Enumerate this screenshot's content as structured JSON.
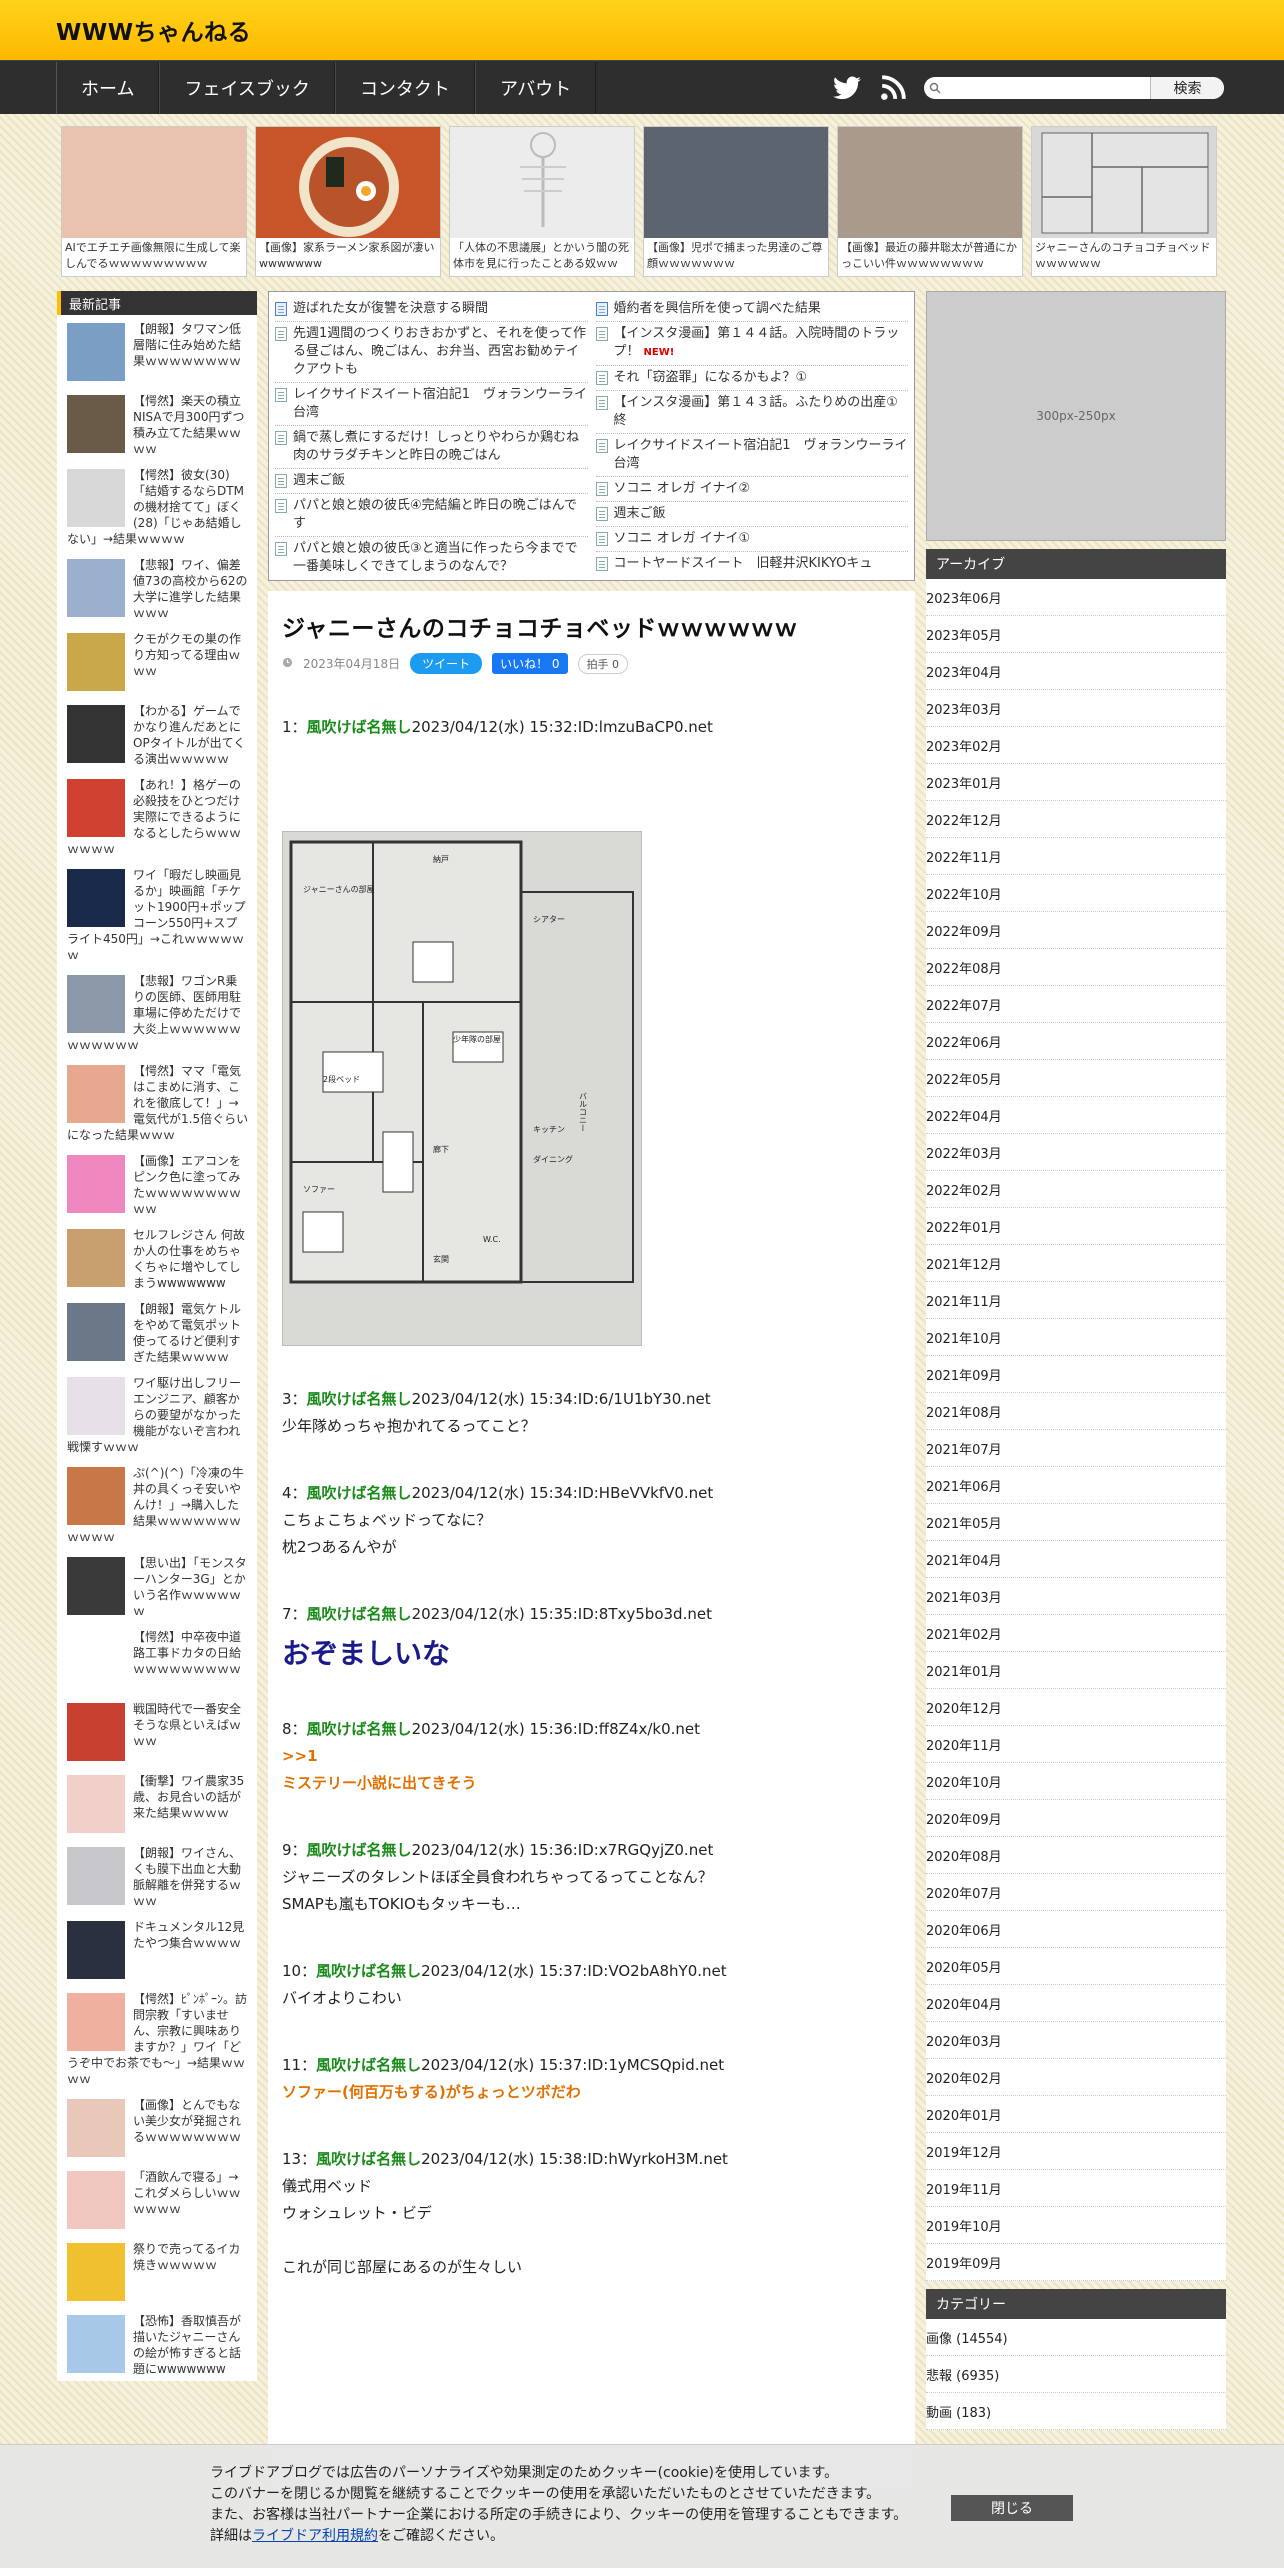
{
  "site": {
    "title": "WWWちゃんねる"
  },
  "nav": {
    "items": [
      "ホーム",
      "フェイスブック",
      "コンタクト",
      "アバウト"
    ],
    "search_placeholder": "",
    "search_button": "検索"
  },
  "featured": [
    {
      "title": "AIでエチエチ画像無限に生成して楽しんでるｗｗｗｗｗｗｗｗｗ",
      "color": "#e9c3b0"
    },
    {
      "title": "【画像】家系ラーメン家系図が凄いwwwwwww",
      "color": "#c8552a"
    },
    {
      "title": "「人体の不思議展」とかいう闇の死体市を見に行ったことある奴ｗｗ",
      "color": "#ececec"
    },
    {
      "title": "【画像】児ポで捕まった男達のご尊顔ｗｗｗｗｗｗｗ",
      "color": "#5c6470"
    },
    {
      "title": "【画像】最近の藤井聡太が普通にかっこいい件ｗｗｗｗｗｗｗｗ",
      "color": "#a99a8c"
    },
    {
      "title": "ジャニーさんのコチョコチョベッドｗｗｗｗｗｗ",
      "color": "#d8d8d8"
    }
  ],
  "recent": {
    "heading": "最新記事",
    "items": [
      {
        "title": "【朗報】タワマン低層階に住み始めた結果ｗｗｗｗｗｗｗｗ",
        "color": "#7a9ec4"
      },
      {
        "title": "【愕然】楽天の積立NISAで月300円ずつ積み立てた結果ｗｗｗｗ",
        "color": "#6a5a48"
      },
      {
        "title": "【愕然】彼女(30)「結婚するならDTMの機材捨てて」ぼく(28)「じゃあ結婚しない」→結果ｗｗｗｗ",
        "color": "#d8d8d8"
      },
      {
        "title": "【悲報】ワイ、偏差値73の高校から62の大学に進学した結果ｗｗｗ",
        "color": "#9ab0cc"
      },
      {
        "title": "クモがクモの巣の作り方知ってる理由ｗｗｗ",
        "color": "#c8a848"
      },
      {
        "title": "【わかる】ゲームでかなり進んだあとにOPタイトルが出てくる演出ｗｗｗｗｗ",
        "color": "#333333"
      },
      {
        "title": "【あれ！】格ゲーの必殺技をひとつだけ実際にできるようになるとしたらｗｗｗｗｗｗｗ",
        "color": "#d04030"
      },
      {
        "title": "ワイ「暇だし映画見るか」映画館「チケット1900円+ポップコーン550円+スプライト450円」→これｗｗｗｗｗｗ",
        "color": "#1a2a4a"
      },
      {
        "title": "【悲報】ワゴンR乗りの医師、医師用駐車場に停めただけで大炎上ｗｗｗｗｗｗｗｗｗｗｗｗ",
        "color": "#8a98a8"
      },
      {
        "title": "【愕然】ママ「電気はこまめに消す、これを徹底して！」→電気代が1.5倍ぐらいになった結果ｗｗｗ",
        "color": "#e8a890"
      },
      {
        "title": "【画像】エアコンをピンク色に塗ってみたｗｗｗｗｗｗｗｗｗｗ",
        "color": "#f088c0"
      },
      {
        "title": "セルフレジさん 何故か人の仕事をめちゃくちゃに増やしてしまうwwwwwww",
        "color": "#c8a070"
      },
      {
        "title": "【朗報】電気ケトルをやめて電気ポット使ってるけど便利すぎた結果ｗｗｗｗ",
        "color": "#6a7888"
      },
      {
        "title": "ワイ駆け出しフリーエンジニア、顧客からの要望がなかった機能がないぞ言われ戦慄すｗｗｗ",
        "color": "#e8e0e8"
      },
      {
        "title": "ぷ(^)(^)「冷凍の牛丼の具くっそ安いやんけ！」→購入した結果ｗｗｗｗｗｗｗｗｗｗｗ",
        "color": "#c87848"
      },
      {
        "title": "【思い出】「モンスターハンター3G」とかいう名作ｗｗｗｗｗｗ",
        "color": "#3a3a3a"
      },
      {
        "title": "【愕然】中卒夜中道路工事ドカタの日給ｗｗｗｗｗｗｗｗｗ",
        "color": "#ffffff"
      },
      {
        "title": "戦国時代で一番安全そうな県といえばｗｗｗ",
        "color": "#c84030"
      },
      {
        "title": "【衝撃】ワイ農家35歳、お見合いの話が来た結果ｗｗｗｗ",
        "color": "#f0d0c8"
      },
      {
        "title": "【朗報】ワイさん、くも膜下出血と大動脈解離を併発するｗｗｗ",
        "color": "#c8c8cc"
      },
      {
        "title": "ドキュメンタル12見たやつ集合ｗｗｗｗ",
        "color": "#2a3040"
      },
      {
        "title": "【愕然】ﾋﾟﾝﾎﾟｰﾝ。訪問宗教「すいません、宗教に興味ありますか？」ワイ「どうぞ中でお茶でも～」→結果ｗｗｗｗ",
        "color": "#f0b0a0"
      },
      {
        "title": "【画像】とんでもない美少女が発掘されるｗｗｗｗｗｗｗｗ",
        "color": "#e8c8b8"
      },
      {
        "title": "「酒飲んで寝る」→これダメらしいｗｗｗｗｗｗ",
        "color": "#f0c8c0"
      },
      {
        "title": "祭りで売ってるイカ焼きｗｗｗｗｗ",
        "color": "#f0c030"
      },
      {
        "title": "【恐怖】香取慎吾が描いたジャニーさんの絵が怖すぎると話題にwwwwwww",
        "color": "#a8c8e8"
      }
    ]
  },
  "links_left": [
    {
      "title": "遊ばれた女が復讐を決意する瞬間",
      "blue": true
    },
    {
      "title": "先週1週間のつくりおきおかずと、それを使って作る昼ごはん、晩ごはん、お弁当、西宮お勧めテイクアウトも",
      "blue": false
    },
    {
      "title": "レイクサイドスイート宿泊記1　ヴォランウーライ台湾",
      "blue": false
    },
    {
      "title": "鍋で蒸し煮にするだけ！しっとりやわらか鶏むね肉のサラダチキンと昨日の晩ごはん",
      "blue": false
    },
    {
      "title": "週末ご飯",
      "blue": false
    },
    {
      "title": "パパと娘と娘の彼氏④完結編と昨日の晩ごはんです",
      "blue": false
    },
    {
      "title": "パパと娘と娘の彼氏③と適当に作ったら今までで一番美味しくできてしまうのなんで？",
      "blue": false
    }
  ],
  "links_right": [
    {
      "title": "婚約者を興信所を使って調べた結果",
      "blue": true,
      "new": ""
    },
    {
      "title": "【インスタ漫画】第１４４話。入院時間のトラップ！",
      "blue": false,
      "new": "NEW!"
    },
    {
      "title": "それ「窃盗罪」になるかもよ？①",
      "blue": false,
      "new": ""
    },
    {
      "title": "【インスタ漫画】第１４３話。ふたりめの出産①終",
      "blue": false,
      "new": ""
    },
    {
      "title": "レイクサイドスイート宿泊記1　ヴォランウーライ台湾",
      "blue": false,
      "new": ""
    },
    {
      "title": "ソコニ オレガ イナイ②",
      "blue": false,
      "new": ""
    },
    {
      "title": "週末ご飯",
      "blue": false,
      "new": ""
    },
    {
      "title": "ソコニ オレガ イナイ①",
      "blue": false,
      "new": ""
    },
    {
      "title": "コートヤードスイート　旧軽井沢KIKYOキュ",
      "blue": false,
      "new": ""
    }
  ],
  "article": {
    "title": "ジャニーさんのコチョコチョベッドｗｗｗｗｗｗ",
    "date": "2023年04月18日",
    "tweet": "ツイート",
    "like": "いいね！ 0",
    "clap": "拍手 0"
  },
  "posts": [
    {
      "num": "1：",
      "name": "風吹けば名無し",
      "info": "2023/04/12(水) 15:32:ID:lmzuBaCP0.net",
      "lines": []
    },
    {
      "num": "3：",
      "name": "風吹けば名無し",
      "info": "2023/04/12(水) 15:34:ID:6/1U1bY30.net",
      "lines": [
        "少年隊めっちゃ抱かれてるってこと？"
      ]
    },
    {
      "num": "4：",
      "name": "風吹けば名無し",
      "info": "2023/04/12(水) 15:34:ID:HBeVVkfV0.net",
      "lines": [
        "こちょこちょベッドってなに？",
        "枕2つあるんやが"
      ]
    },
    {
      "num": "7：",
      "name": "風吹けば名無し",
      "info": "2023/04/12(水) 15:35:ID:8Txy5bo3d.net",
      "big": "おぞましいな"
    },
    {
      "num": "8：",
      "name": "風吹けば名無し",
      "info": "2023/04/12(水) 15:36:ID:ff8Z4x/k0.net",
      "anchor": ">>1",
      "orange": "ミステリー小説に出てきそう"
    },
    {
      "num": "9：",
      "name": "風吹けば名無し",
      "info": "2023/04/12(水) 15:36:ID:x7RGQyjZ0.net",
      "lines": [
        "ジャニーズのタレントほぼ全員食われちゃってるってことなん？",
        "SMAPも嵐もTOKIOもタッキーも…"
      ]
    },
    {
      "num": "10：",
      "name": "風吹けば名無し",
      "info": "2023/04/12(水) 15:37:ID:VO2bA8hY0.net",
      "lines": [
        "バイオよりこわい"
      ]
    },
    {
      "num": "11：",
      "name": "風吹けば名無し",
      "info": "2023/04/12(水) 15:37:ID:1yMCSQpid.net",
      "orange": "ソファー(何百万もする)がちょっとツボだわ"
    },
    {
      "num": "13：",
      "name": "風吹けば名無し",
      "info": "2023/04/12(水) 15:38:ID:hWyrkoH3M.net",
      "lines": [
        "儀式用ベッド",
        "ウォシュレット・ビデ",
        "",
        "これが同じ部屋にあるのが生々しい"
      ]
    }
  ],
  "floorplan": {
    "labels": [
      "納戸",
      "バルコニー",
      "廊下",
      "玄関",
      "2段ベッド",
      "少年隊の部屋",
      "キッチン",
      "ダイニング",
      "ジャニーさんの部屋",
      "シアター",
      "ソファー",
      "W.C."
    ]
  },
  "ad": {
    "label": "300px-250px"
  },
  "archive": {
    "heading": "アーカイブ",
    "items": [
      "2023年06月",
      "2023年05月",
      "2023年04月",
      "2023年03月",
      "2023年02月",
      "2023年01月",
      "2022年12月",
      "2022年11月",
      "2022年10月",
      "2022年09月",
      "2022年08月",
      "2022年07月",
      "2022年06月",
      "2022年05月",
      "2022年04月",
      "2022年03月",
      "2022年02月",
      "2022年01月",
      "2021年12月",
      "2021年11月",
      "2021年10月",
      "2021年09月",
      "2021年08月",
      "2021年07月",
      "2021年06月",
      "2021年05月",
      "2021年04月",
      "2021年03月",
      "2021年02月",
      "2021年01月",
      "2020年12月",
      "2020年11月",
      "2020年10月",
      "2020年09月",
      "2020年08月",
      "2020年07月",
      "2020年06月",
      "2020年05月",
      "2020年04月",
      "2020年03月",
      "2020年02月",
      "2020年01月",
      "2019年12月",
      "2019年11月",
      "2019年10月",
      "2019年09月"
    ]
  },
  "category": {
    "heading": "カテゴリー",
    "items": [
      "画像 (14554)",
      "悲報 (6935)",
      "動画 (183)"
    ]
  },
  "cookie": {
    "line1": "ライブドアブログでは広告のパーソナライズや効果測定のためクッキー(cookie)を使用しています。",
    "line2": "このバナーを閉じるか閲覧を継続することでクッキーの使用を承認いただいたものとさせていただきます。",
    "line3": "また、お客様は当社パートナー企業における所定の手続きにより、クッキーの使用を管理することもできます。",
    "line4_pre": "詳細は",
    "line4_link": "ライブドア利用規約",
    "line4_post": "をご確認ください。",
    "close": "閉じる"
  }
}
